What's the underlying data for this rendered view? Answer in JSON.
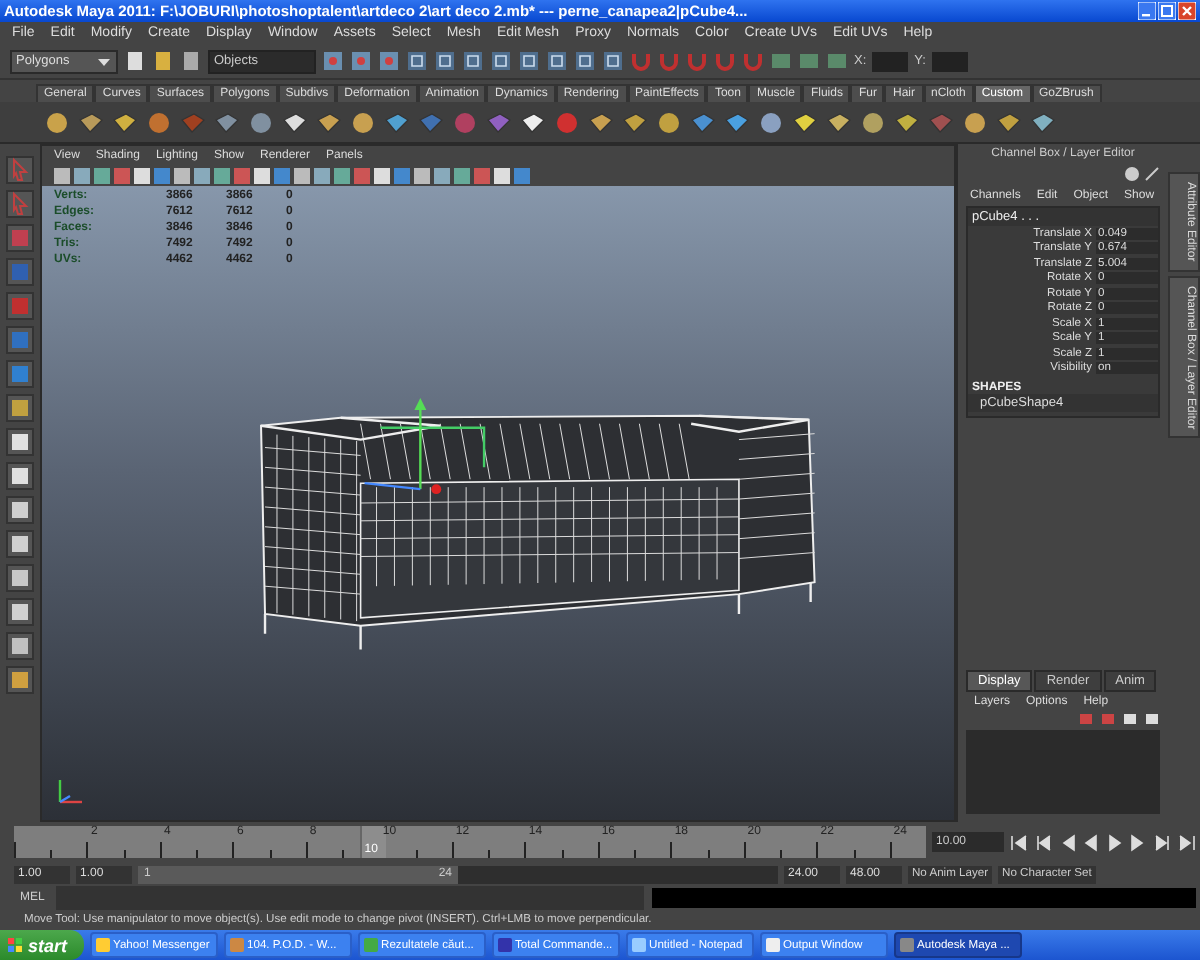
{
  "window": {
    "title": "Autodesk Maya 2011: F:\\JOBURI\\photoshoptalent\\artdeco 2\\art deco 2.mb*  ---  perne_canapea2|pCube4..."
  },
  "menu": [
    "File",
    "Edit",
    "Modify",
    "Create",
    "Display",
    "Window",
    "Assets",
    "Select",
    "Mesh",
    "Edit Mesh",
    "Proxy",
    "Normals",
    "Color",
    "Create UVs",
    "Edit UVs",
    "Help"
  ],
  "status_line": {
    "menu_set": "Polygons",
    "selection_field": "Objects",
    "coord_labels": [
      "X:",
      "Y:"
    ]
  },
  "shelf_tabs": [
    {
      "label": "General",
      "selected": false
    },
    {
      "label": "Curves",
      "selected": false
    },
    {
      "label": "Surfaces",
      "selected": false
    },
    {
      "label": "Polygons",
      "selected": false
    },
    {
      "label": "Subdivs",
      "selected": false
    },
    {
      "label": "Deformation",
      "selected": false
    },
    {
      "label": "Animation",
      "selected": false
    },
    {
      "label": "Dynamics",
      "selected": false
    },
    {
      "label": "Rendering",
      "selected": false
    },
    {
      "label": "PaintEffects",
      "selected": false
    },
    {
      "label": "Toon",
      "selected": false
    },
    {
      "label": "Muscle",
      "selected": false
    },
    {
      "label": "Fluids",
      "selected": false
    },
    {
      "label": "Fur",
      "selected": false
    },
    {
      "label": "Hair",
      "selected": false
    },
    {
      "label": "nCloth",
      "selected": false
    },
    {
      "label": "Custom",
      "selected": true
    },
    {
      "label": "GoZBrush",
      "selected": false
    }
  ],
  "viewport": {
    "menu": [
      "View",
      "Shading",
      "Lighting",
      "Show",
      "Renderer",
      "Panels"
    ],
    "stats": [
      {
        "label": "Verts:",
        "values": [
          "3866",
          "3866",
          "0"
        ]
      },
      {
        "label": "Edges:",
        "values": [
          "7612",
          "7612",
          "0"
        ]
      },
      {
        "label": "Faces:",
        "values": [
          "3846",
          "3846",
          "0"
        ]
      },
      {
        "label": "Tris:",
        "values": [
          "7492",
          "7492",
          "0"
        ]
      },
      {
        "label": "UVs:",
        "values": [
          "4462",
          "4462",
          "0"
        ]
      }
    ]
  },
  "channel_box": {
    "title": "Channel Box / Layer Editor",
    "menu": [
      "Channels",
      "Edit",
      "Object",
      "Show"
    ],
    "object": "pCube4 . . .",
    "attributes": [
      {
        "name": "Translate X",
        "value": "0.049"
      },
      {
        "name": "Translate Y",
        "value": "0.674"
      },
      {
        "name": "Translate Z",
        "value": "5.004"
      },
      {
        "name": "Rotate X",
        "value": "0"
      },
      {
        "name": "Rotate Y",
        "value": "0"
      },
      {
        "name": "Rotate Z",
        "value": "0"
      },
      {
        "name": "Scale X",
        "value": "1"
      },
      {
        "name": "Scale Y",
        "value": "1"
      },
      {
        "name": "Scale Z",
        "value": "1"
      },
      {
        "name": "Visibility",
        "value": "on"
      }
    ],
    "shapes_heading": "SHAPES",
    "shape": "pCubeShape4"
  },
  "side_tabs": [
    "Attribute Editor",
    "Channel Box / Layer Editor"
  ],
  "layer_editor": {
    "tabs": [
      {
        "label": "Display",
        "selected": true
      },
      {
        "label": "Render",
        "selected": false
      },
      {
        "label": "Anim",
        "selected": false
      }
    ],
    "menu": [
      "Layers",
      "Options",
      "Help"
    ]
  },
  "timeline": {
    "ticks": [
      "2",
      "4",
      "6",
      "8",
      "10",
      "12",
      "14",
      "16",
      "18",
      "20",
      "22",
      "24"
    ],
    "current": "10",
    "level": 0.38,
    "current_field": "10.00"
  },
  "range_slider": {
    "start": "1.00",
    "playback_start": "1.00",
    "handle_start": "1",
    "handle_end": "24",
    "level": 0.5,
    "playback_end": "24.00",
    "end": "48.00",
    "anim_layer": "No Anim Layer",
    "character_set": "No Character Set"
  },
  "command_line": {
    "label": "MEL"
  },
  "help_line": "Move Tool: Use manipulator to move object(s). Use edit mode to change pivot (INSERT). Ctrl+LMB to move perpendicular.",
  "taskbar": {
    "start": "start",
    "items": [
      {
        "label": "Yahoo! Messenger",
        "selected": false
      },
      {
        "label": "104. P.O.D. - W...",
        "selected": false
      },
      {
        "label": "Rezultatele căut...",
        "selected": false
      },
      {
        "label": "Total Commande...",
        "selected": false
      },
      {
        "label": "Untitled - Notepad",
        "selected": false
      },
      {
        "label": "Output Window",
        "selected": false
      },
      {
        "label": "Autodesk Maya ...",
        "selected": true
      }
    ]
  }
}
